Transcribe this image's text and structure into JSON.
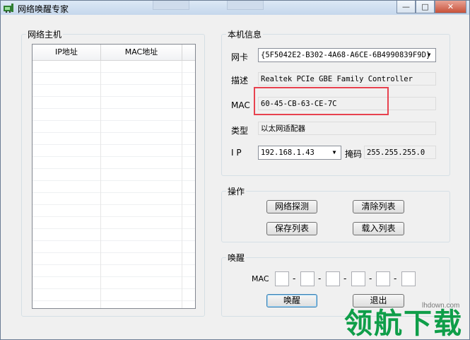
{
  "window": {
    "title": "网络唤醒专家",
    "controls": [
      "—",
      "□",
      "✕"
    ]
  },
  "hosts": {
    "title": "网络主机",
    "columns": [
      "IP地址",
      "MAC地址"
    ]
  },
  "local": {
    "title": "本机信息",
    "nic_label": "网卡",
    "nic_value": "{5F5042E2-B302-4A68-A6CE-6B4990839F9D}",
    "desc_label": "描述",
    "desc_value": "Realtek PCIe GBE Family Controller",
    "mac_label": "MAC",
    "mac_value": "60-45-CB-63-CE-7C",
    "type_label": "类型",
    "type_value": "以太网适配器",
    "ip_label": "I P",
    "ip_value": "192.168.1.43",
    "mask_label": "掩码",
    "mask_value": "255.255.255.0"
  },
  "ops": {
    "title": "操作",
    "probe": "网络探测",
    "clear": "清除列表",
    "save": "保存列表",
    "load": "载入列表"
  },
  "wake": {
    "title": "唤醒",
    "mac_label": "MAC",
    "sep": "-",
    "wake_btn": "唤醒",
    "exit_btn": "退出"
  },
  "watermark": {
    "logo_text": "领航下载",
    "site": "lhdown.com"
  },
  "colors": {
    "highlight": "#e8424f",
    "watermark": "#0f9e49"
  }
}
